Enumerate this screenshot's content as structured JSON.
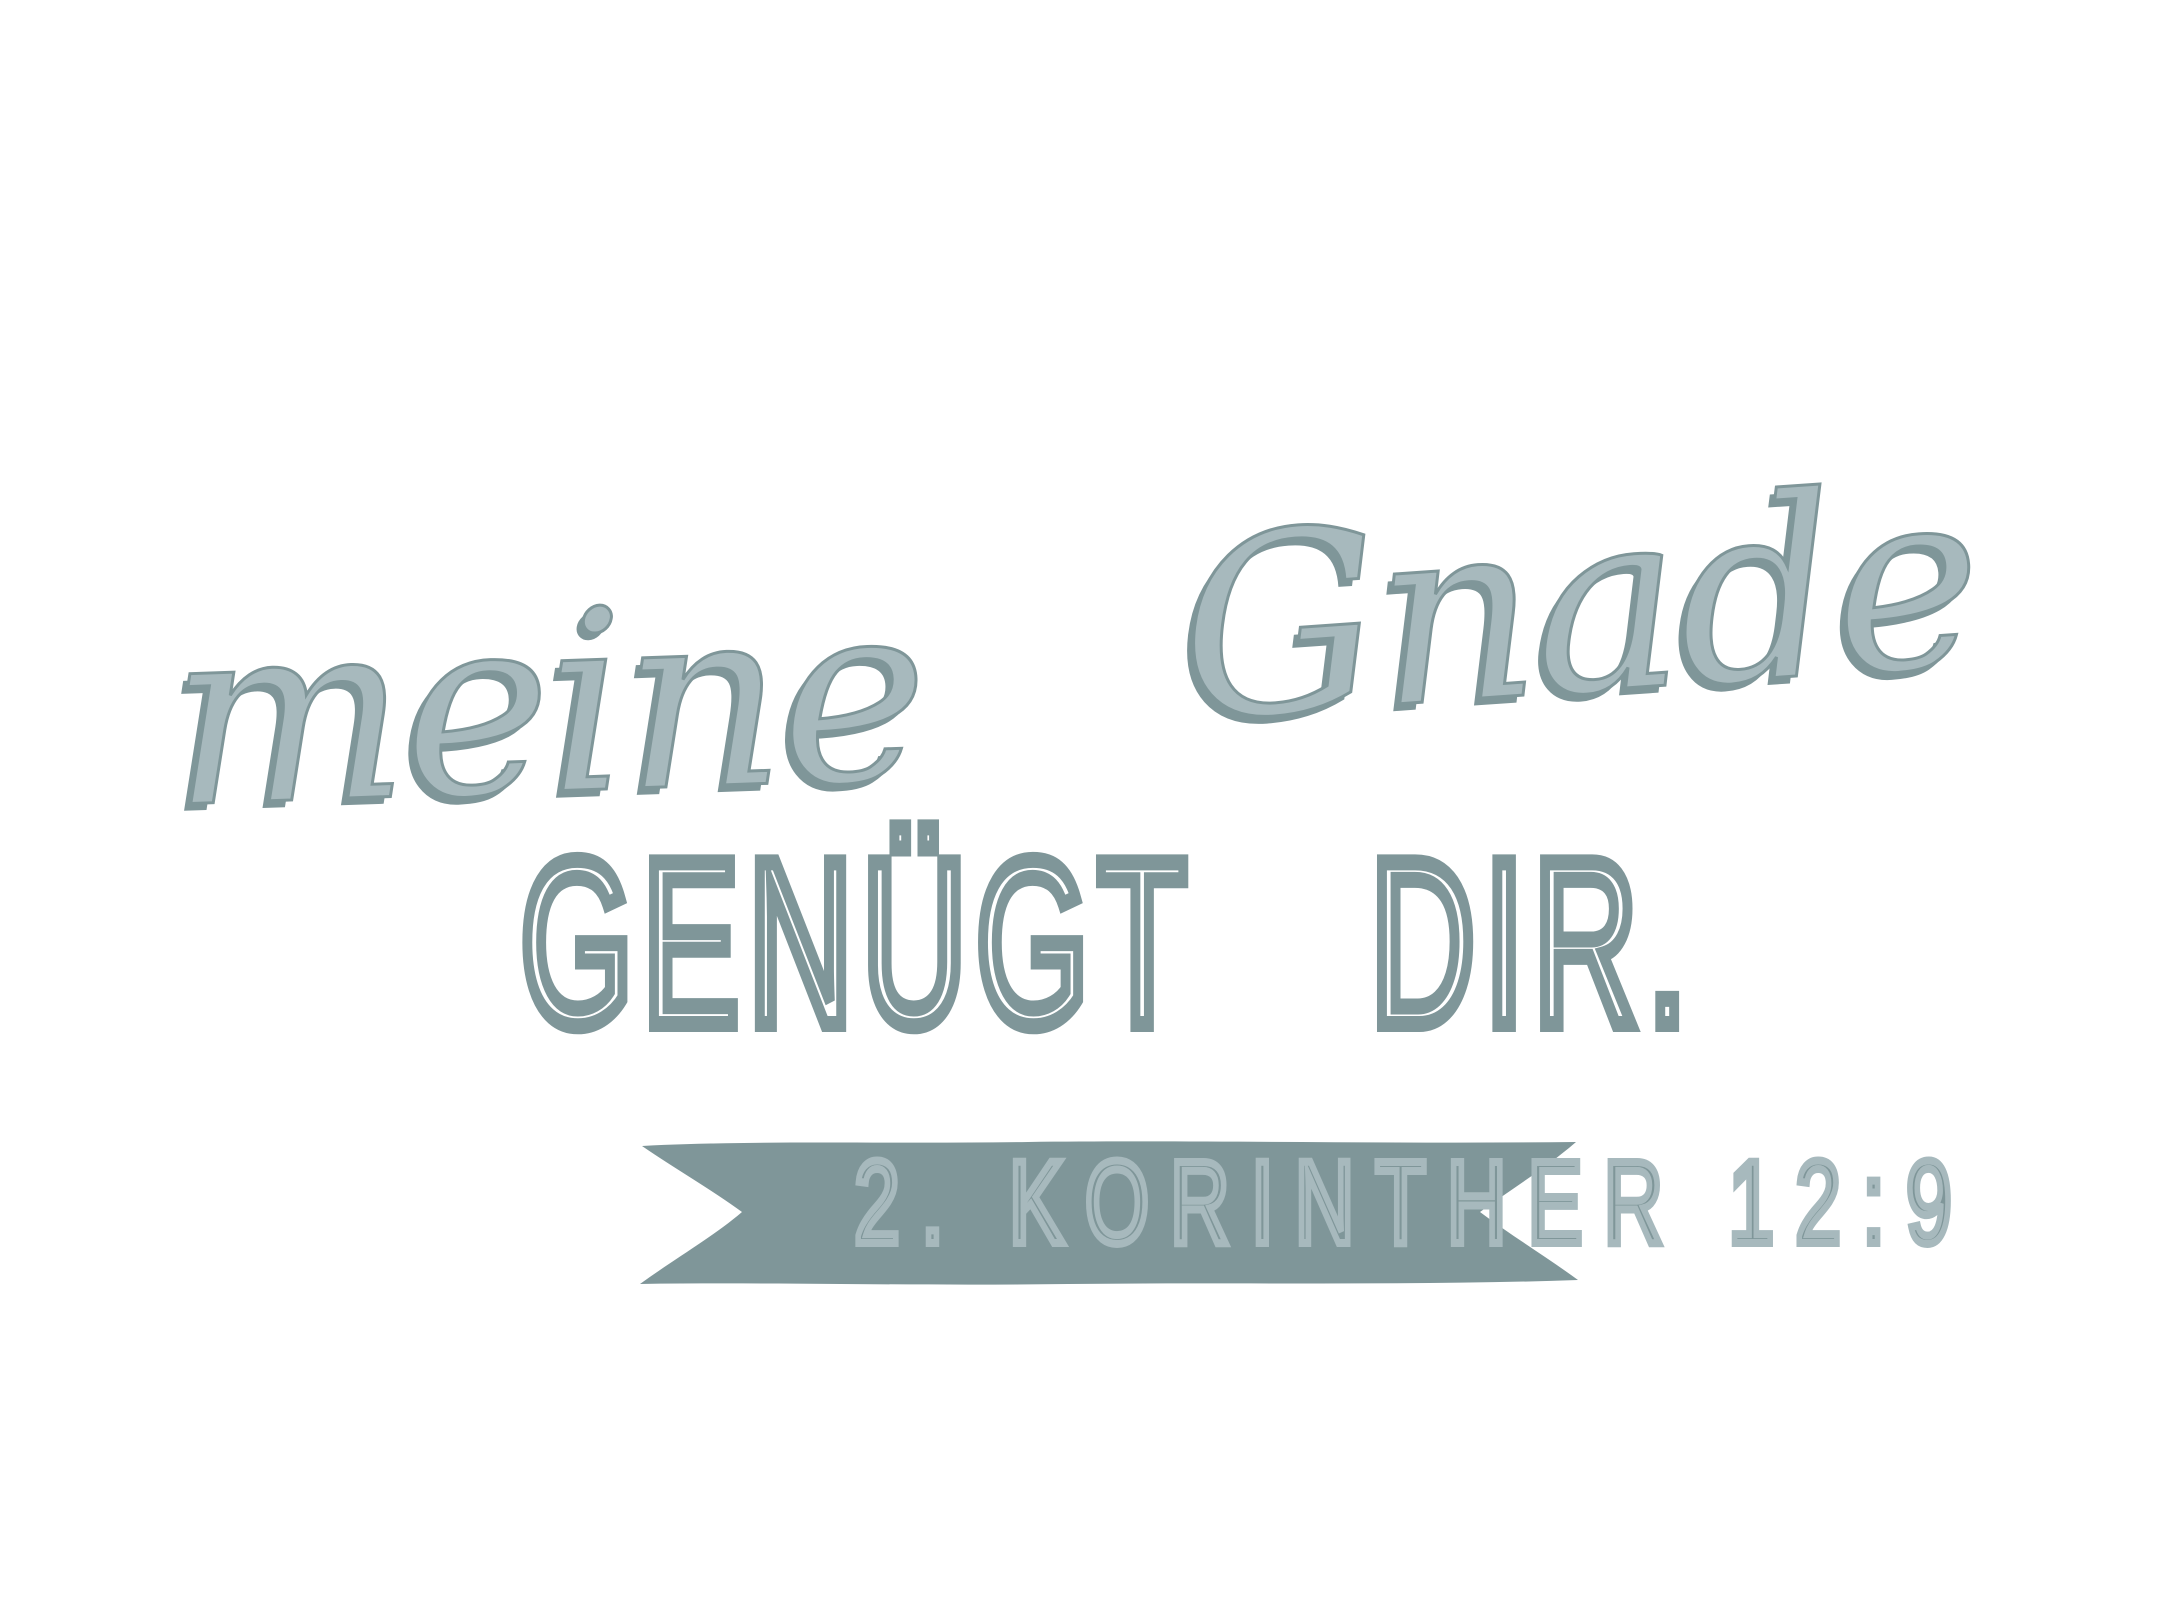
{
  "artwork": {
    "script_words": {
      "first": "meine",
      "second": "Gnade"
    },
    "caps_words": {
      "first": "GENÜGT",
      "second": "DIR."
    },
    "reference": "2. KORINTHER 12:9",
    "colors": {
      "background": "#ffffff",
      "light_slate": "#a7b9bd",
      "dark_slate": "#7f9699"
    }
  }
}
